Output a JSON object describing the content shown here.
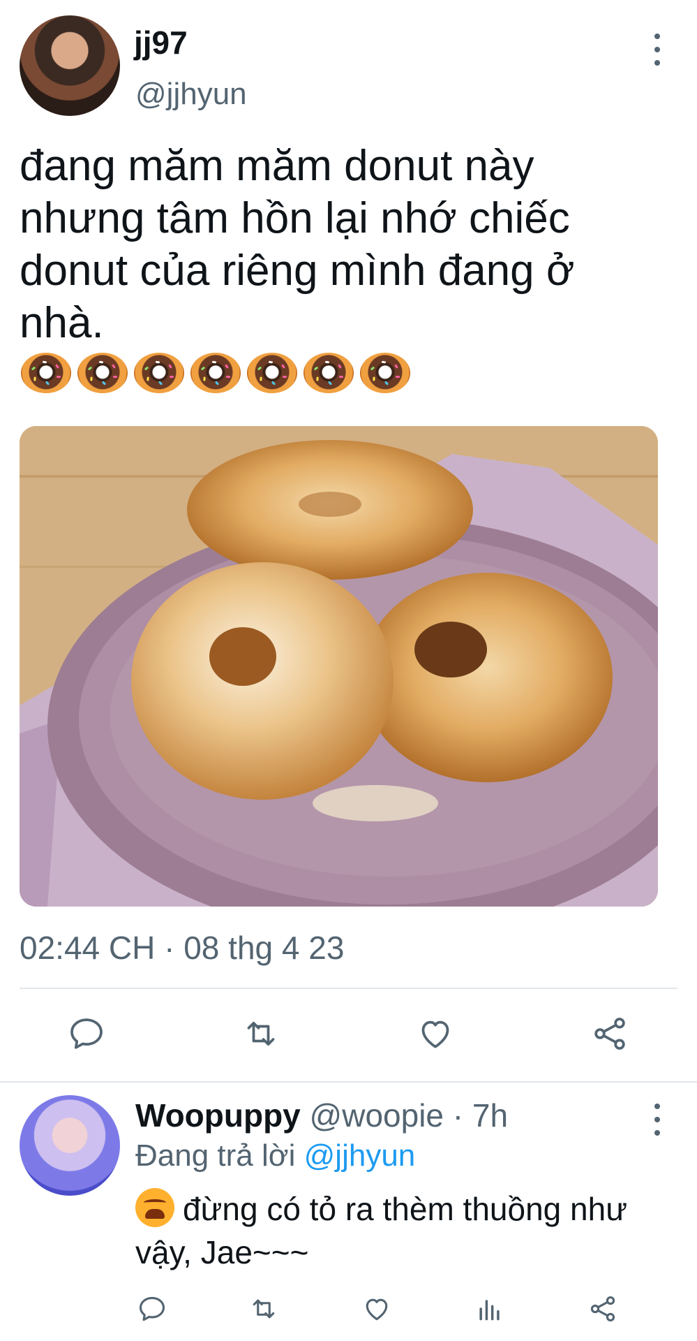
{
  "tweet": {
    "author_name": "jj97",
    "author_handle": "@jjhyun",
    "text": "đang măm măm donut này\nnhưng tâm hồn lại nhớ chiếc\ndonut của riêng mình đang ở\nnhà.",
    "emoji_count": 7,
    "timestamp": "02:44 CH · 08 thg 4 23"
  },
  "reply": {
    "author_name": "Woopuppy",
    "author_handle": "@woopie",
    "age": "· 7h",
    "replying_prefix": "Đang trả lời",
    "replying_to": "@jjhyun",
    "text": "đừng có tỏ ra thèm thuồng như vậy, Jae~~~"
  },
  "icons": {
    "more": "more-vertical-icon",
    "reply": "comment-icon",
    "retweet": "retweet-icon",
    "like": "heart-icon",
    "share": "share-icon",
    "analytics": "analytics-icon"
  },
  "colors": {
    "text_primary": "#0f1419",
    "text_secondary": "#536471",
    "link": "#1d9bf0",
    "divider": "#e1e6ea"
  }
}
